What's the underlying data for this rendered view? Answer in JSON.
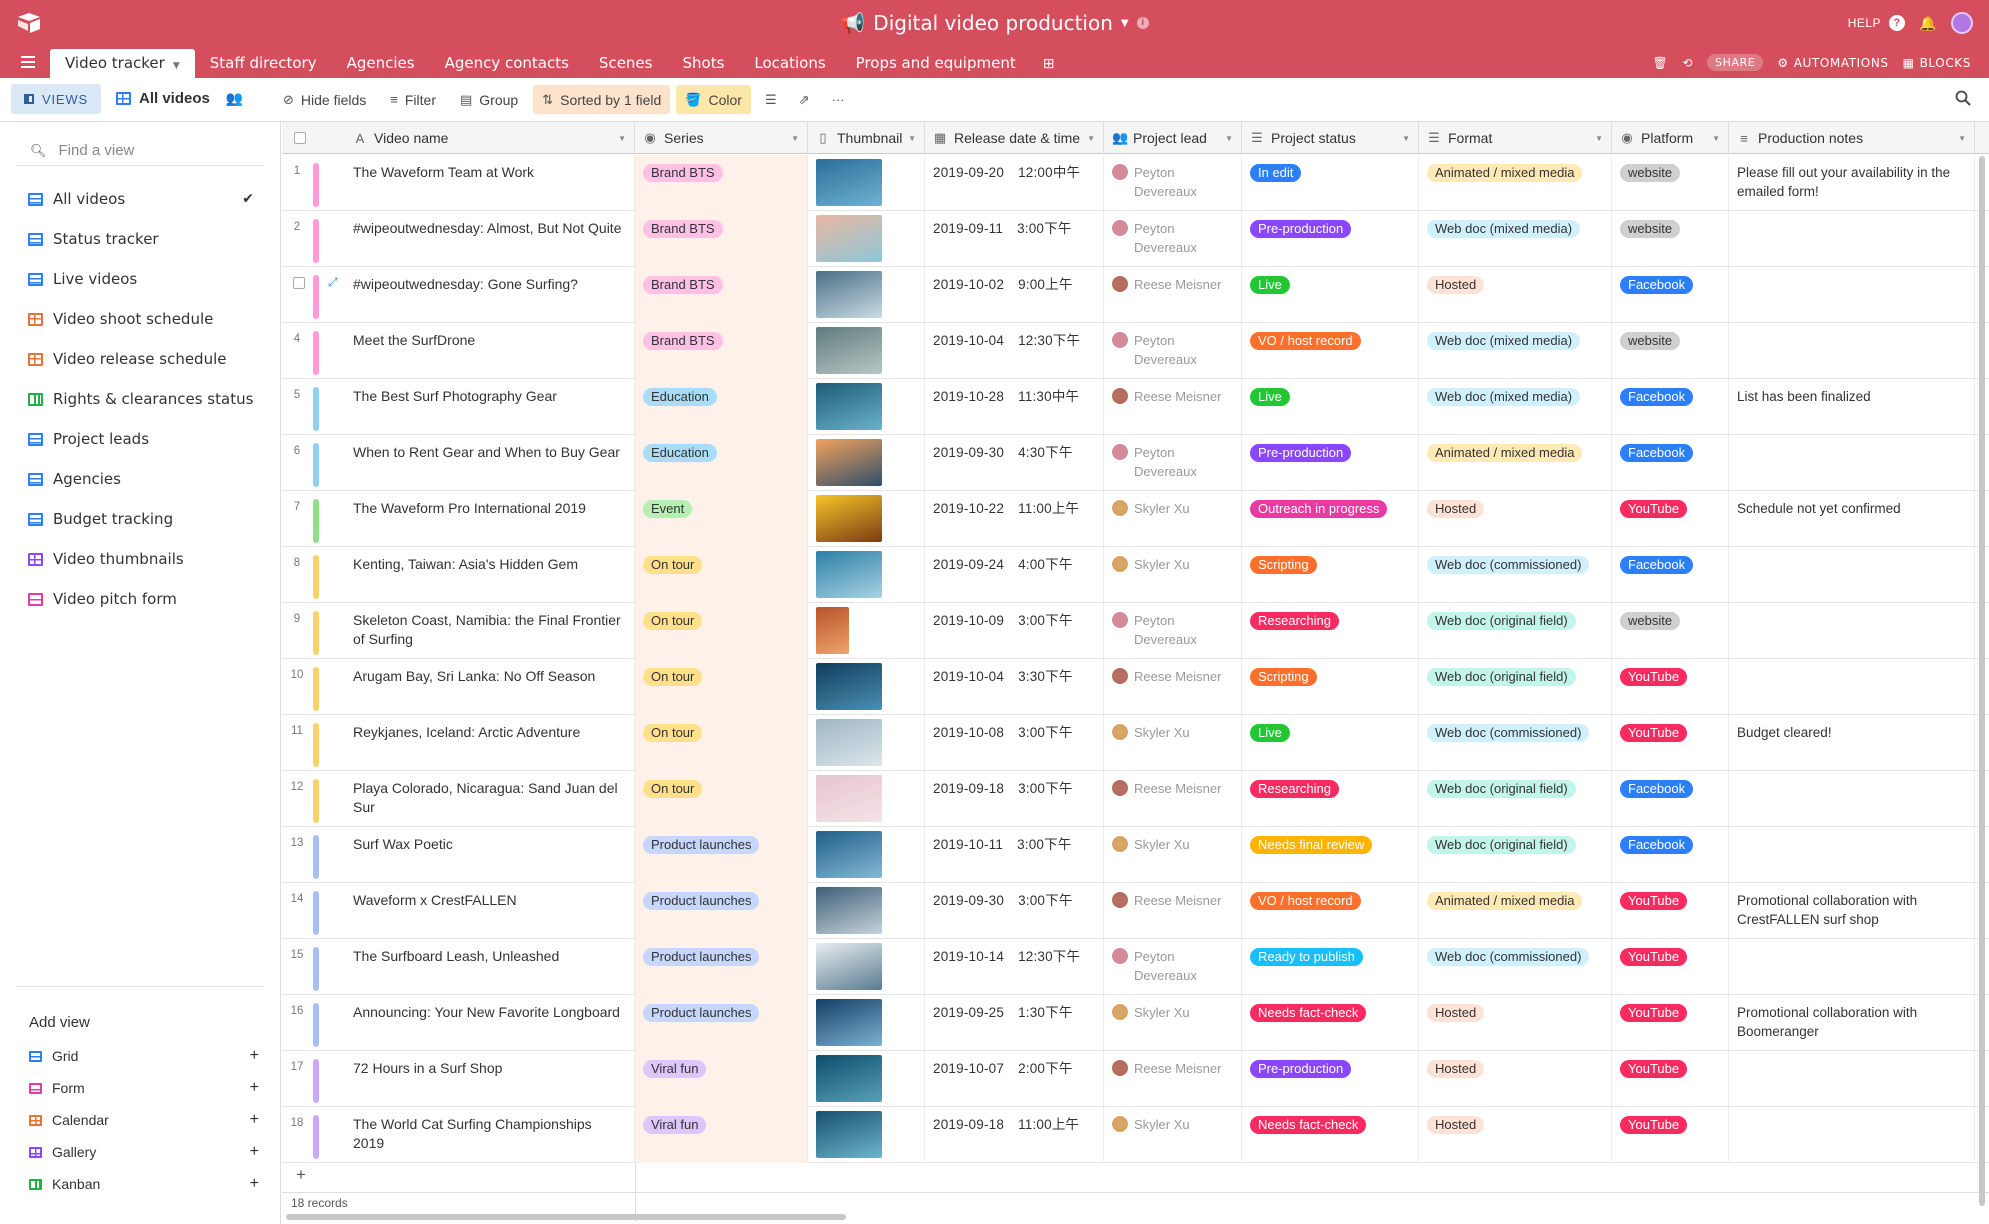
{
  "app": {
    "base_title": "Digital video production",
    "help_label": "HELP"
  },
  "tabs": [
    "Video tracker",
    "Staff directory",
    "Agencies",
    "Agency contacts",
    "Scenes",
    "Shots",
    "Locations",
    "Props and equipment"
  ],
  "tabbar_right": {
    "share_label": "SHARE",
    "automations_label": "AUTOMATIONS",
    "blocks_label": "BLOCKS"
  },
  "toolbar": {
    "views_label": "VIEWS",
    "current_view": "All videos",
    "hide_fields": "Hide fields",
    "filter": "Filter",
    "group": "Group",
    "sorted": "Sorted by 1 field",
    "color": "Color"
  },
  "sidebar": {
    "find_placeholder": "Find a view",
    "views": [
      {
        "label": "All videos",
        "type": "grid",
        "active": true
      },
      {
        "label": "Status tracker",
        "type": "grid"
      },
      {
        "label": "Live videos",
        "type": "grid"
      },
      {
        "label": "Video shoot schedule",
        "type": "cal"
      },
      {
        "label": "Video release schedule",
        "type": "cal"
      },
      {
        "label": "Rights & clearances status",
        "type": "kanban"
      },
      {
        "label": "Project leads",
        "type": "grid"
      },
      {
        "label": "Agencies",
        "type": "grid"
      },
      {
        "label": "Budget tracking",
        "type": "grid"
      },
      {
        "label": "Video thumbnails",
        "type": "gallery"
      },
      {
        "label": "Video pitch form",
        "type": "form"
      }
    ],
    "add_view_title": "Add view",
    "add_view_items": [
      {
        "label": "Grid",
        "type": "grid"
      },
      {
        "label": "Form",
        "type": "form"
      },
      {
        "label": "Calendar",
        "type": "cal"
      },
      {
        "label": "Gallery",
        "type": "gallery"
      },
      {
        "label": "Kanban",
        "type": "kanban"
      }
    ]
  },
  "columns": [
    "Video name",
    "Series",
    "Thumbnail",
    "Release date & time",
    "Project lead",
    "Project status",
    "Format",
    "Platform",
    "Production notes"
  ],
  "colors": {
    "brand": "#d54e5d",
    "series": {
      "Brand BTS": {
        "bg": "#ffc0e6",
        "bar": "#ff9ada"
      },
      "Education": {
        "bg": "#a8ddf5",
        "bar": "#8fd1ee"
      },
      "Event": {
        "bg": "#b6efb2",
        "bar": "#8ee08a"
      },
      "On tour": {
        "bg": "#ffe08a",
        "bar": "#fbd36a"
      },
      "Product launches": {
        "bg": "#c7d7fb",
        "bar": "#a7bff5"
      },
      "Viral fun": {
        "bg": "#dcc6fb",
        "bar": "#cba8f7"
      }
    },
    "status": {
      "In edit": "#2d7ff9",
      "Pre-production": "#8b46ff",
      "Live": "#20c933",
      "VO / host record": "#ff6f2c",
      "Outreach in progress": "#e93aa3",
      "Scripting": "#ff6f2c",
      "Researching": "#f82b60",
      "Needs final review": "#fcb400",
      "Ready to publish": "#18bfff",
      "Needs fact-check": "#f82b60"
    },
    "format": {
      "Animated / mixed media": "#ffeab6",
      "Web doc (mixed media)": "#d0f0fd",
      "Hosted": "#fee2d5",
      "Web doc (commissioned)": "#d0f0fd",
      "Web doc (original field)": "#c2f5e9"
    },
    "platform": {
      "website": "#cfcfcf",
      "Facebook": "#2d7ff9",
      "YouTube": "#f82b60"
    },
    "leads": {
      "Peyton Devereaux": "#d38a9a",
      "Reese Meisner": "#b86e5e",
      "Skyler Xu": "#d6a463"
    }
  },
  "rows": [
    {
      "num": "1",
      "name": "The Waveform Team at Work",
      "series": "Brand BTS",
      "thumb": "#2a6e9a,#6fb2d1",
      "date": "2019-09-20",
      "time": "12:00中午",
      "lead": "Peyton Devereaux",
      "status": "In edit",
      "format": "Animated / mixed media",
      "platform": "website",
      "notes": "Please fill out your availability in the emailed form!"
    },
    {
      "num": "2",
      "name": "#wipeoutwednesday: Almost, But Not Quite",
      "series": "Brand BTS",
      "thumb": "#e8b7a0,#8ec6d8",
      "date": "2019-09-11",
      "time": "3:00下午",
      "lead": "Peyton Devereaux",
      "status": "Pre-production",
      "format": "Web doc (mixed media)",
      "platform": "website",
      "notes": ""
    },
    {
      "num": "",
      "name": "#wipeoutwednesday: Gone Surfing?",
      "series": "Brand BTS",
      "thumb": "#4a6f86,#c9dbe4",
      "date": "2019-10-02",
      "time": "9:00上午",
      "lead": "Reese Meisner",
      "status": "Live",
      "format": "Hosted",
      "platform": "Facebook",
      "notes": ""
    },
    {
      "num": "4",
      "name": "Meet the SurfDrone",
      "series": "Brand BTS",
      "thumb": "#5f7a7e,#b8c8c4",
      "date": "2019-10-04",
      "time": "12:30下午",
      "lead": "Peyton Devereaux",
      "status": "VO / host record",
      "format": "Web doc (mixed media)",
      "platform": "website",
      "notes": ""
    },
    {
      "num": "5",
      "name": "The Best Surf Photography Gear",
      "series": "Education",
      "thumb": "#1e5a77,#6ab3c9",
      "date": "2019-10-28",
      "time": "11:30中午",
      "lead": "Reese Meisner",
      "status": "Live",
      "format": "Web doc (mixed media)",
      "platform": "Facebook",
      "notes": "List has been finalized"
    },
    {
      "num": "6",
      "name": "When to Rent Gear and When to Buy Gear",
      "series": "Education",
      "thumb": "#f3a25c,#2f4e6a",
      "date": "2019-09-30",
      "time": "4:30下午",
      "lead": "Peyton Devereaux",
      "status": "Pre-production",
      "format": "Animated / mixed media",
      "platform": "Facebook",
      "notes": ""
    },
    {
      "num": "7",
      "name": "The Waveform Pro International 2019",
      "series": "Event",
      "thumb": "#f7c42a,#7a3c12",
      "date": "2019-10-22",
      "time": "11:00上午",
      "lead": "Skyler Xu",
      "status": "Outreach in progress",
      "format": "Hosted",
      "platform": "YouTube",
      "notes": "Schedule not yet confirmed"
    },
    {
      "num": "8",
      "name": "Kenting, Taiwan: Asia's Hidden Gem",
      "series": "On tour",
      "thumb": "#2a7fa7,#a9d2e2",
      "date": "2019-09-24",
      "time": "4:00下午",
      "lead": "Skyler Xu",
      "status": "Scripting",
      "format": "Web doc (commissioned)",
      "platform": "Facebook",
      "notes": ""
    },
    {
      "num": "9",
      "name": "Skeleton Coast, Namibia: the Final Frontier of Surfing",
      "series": "On tour",
      "thumb": "#b8532a,#f0a36b",
      "date": "2019-10-09",
      "time": "3:00下午",
      "lead": "Peyton Devereaux",
      "status": "Researching",
      "format": "Web doc (original field)",
      "platform": "website",
      "notes": ""
    },
    {
      "num": "10",
      "name": "Arugam Bay, Sri Lanka: No Off Season",
      "series": "On tour",
      "thumb": "#0f3d5c,#4b8fb2",
      "date": "2019-10-04",
      "time": "3:30下午",
      "lead": "Reese Meisner",
      "status": "Scripting",
      "format": "Web doc (original field)",
      "platform": "YouTube",
      "notes": ""
    },
    {
      "num": "11",
      "name": "Reykjanes, Iceland: Arctic Adventure",
      "series": "On tour",
      "thumb": "#9fb6c4,#dce6ea",
      "date": "2019-10-08",
      "time": "3:00下午",
      "lead": "Skyler Xu",
      "status": "Live",
      "format": "Web doc (commissioned)",
      "platform": "YouTube",
      "notes": "Budget cleared!"
    },
    {
      "num": "12",
      "name": "Playa Colorado, Nicaragua: Sand Juan del Sur",
      "series": "On tour",
      "thumb": "#e6c4cf,#f5e3e8",
      "date": "2019-09-18",
      "time": "3:00下午",
      "lead": "Reese Meisner",
      "status": "Researching",
      "format": "Web doc (original field)",
      "platform": "Facebook",
      "notes": ""
    },
    {
      "num": "13",
      "name": "Surf Wax Poetic",
      "series": "Product launches",
      "thumb": "#1f5f8a,#86b8d4",
      "date": "2019-10-11",
      "time": "3:00下午",
      "lead": "Skyler Xu",
      "status": "Needs final review",
      "format": "Web doc (original field)",
      "platform": "Facebook",
      "notes": ""
    },
    {
      "num": "14",
      "name": "Waveform x CrestFALLEN",
      "series": "Product launches",
      "thumb": "#3d5f78,#c7d3da",
      "date": "2019-09-30",
      "time": "3:00下午",
      "lead": "Reese Meisner",
      "status": "VO / host record",
      "format": "Animated / mixed media",
      "platform": "YouTube",
      "notes": "Promotional collaboration with CrestFALLEN surf shop"
    },
    {
      "num": "15",
      "name": "The Surfboard Leash, Unleashed",
      "series": "Product launches",
      "thumb": "#e9eef1,#5a7b8f",
      "date": "2019-10-14",
      "time": "12:30下午",
      "lead": "Peyton Devereaux",
      "status": "Ready to publish",
      "format": "Web doc (commissioned)",
      "platform": "YouTube",
      "notes": ""
    },
    {
      "num": "16",
      "name": "Announcing: Your New Favorite Longboard",
      "series": "Product launches",
      "thumb": "#133f66,#7fb0d0",
      "date": "2019-09-25",
      "time": "1:30下午",
      "lead": "Skyler Xu",
      "status": "Needs fact-check",
      "format": "Hosted",
      "platform": "YouTube",
      "notes": "Promotional collaboration with Boomeranger"
    },
    {
      "num": "17",
      "name": "72 Hours in a Surf Shop",
      "series": "Viral fun",
      "thumb": "#0c4d6b,#5aa0b8",
      "date": "2019-10-07",
      "time": "2:00下午",
      "lead": "Reese Meisner",
      "status": "Pre-production",
      "format": "Hosted",
      "platform": "YouTube",
      "notes": ""
    },
    {
      "num": "18",
      "name": "The World Cat Surfing Championships 2019",
      "series": "Viral fun",
      "thumb": "#16506f,#6fb4cc",
      "date": "2019-09-18",
      "time": "11:00上午",
      "lead": "Skyler Xu",
      "status": "Needs fact-check",
      "format": "Hosted",
      "platform": "YouTube",
      "notes": ""
    }
  ],
  "footer": {
    "records_label": "18 records"
  }
}
